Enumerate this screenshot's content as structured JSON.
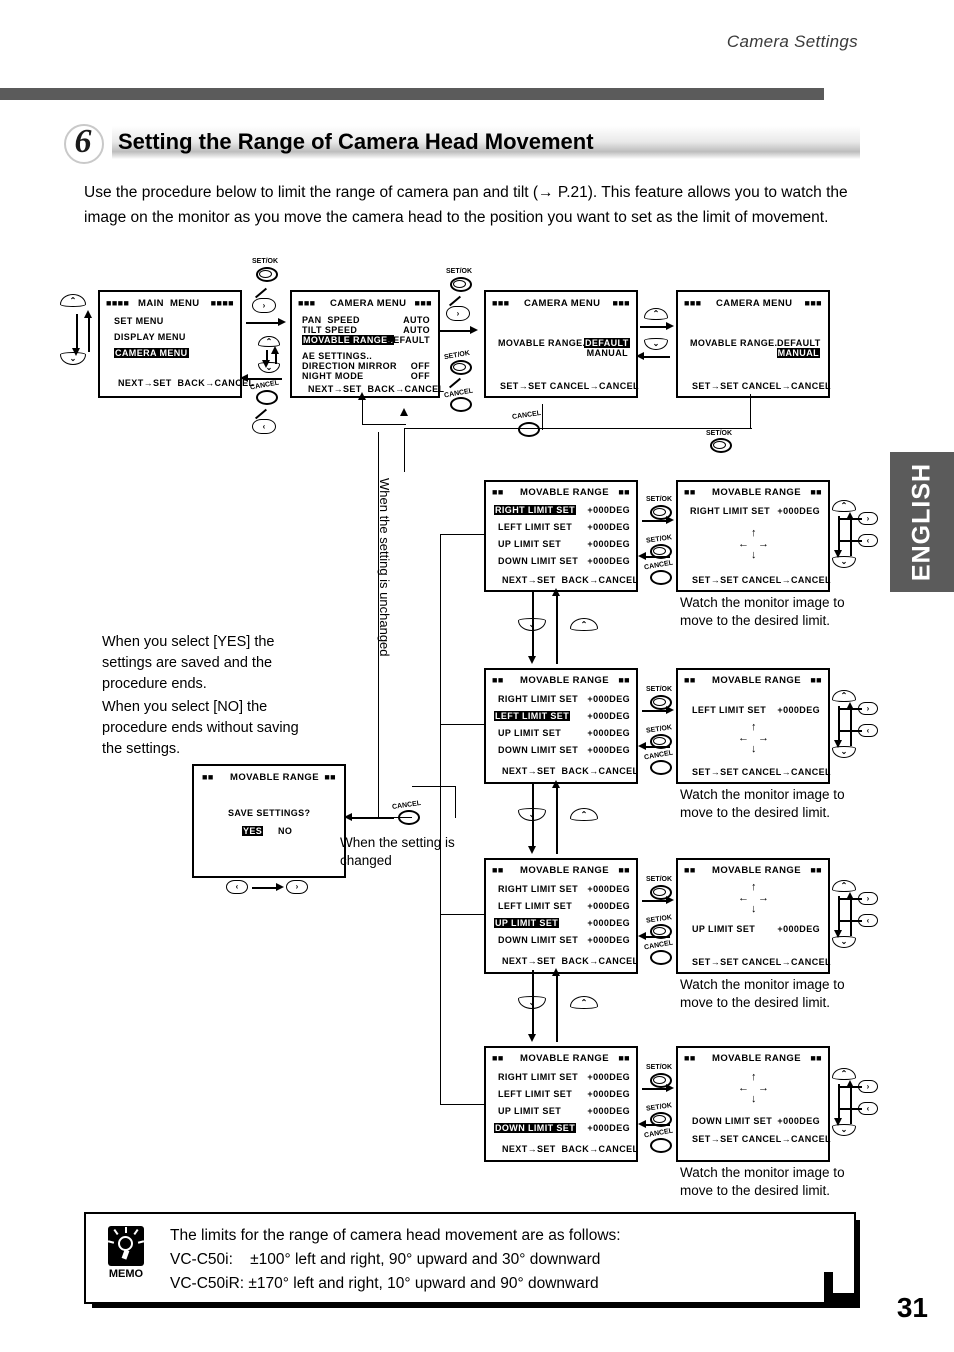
{
  "header": {
    "title": "Camera Settings",
    "side_tab": "ENGLISH",
    "page_number": "31"
  },
  "section": {
    "number": "6",
    "title": "Setting the Range of Camera Head Movement",
    "intro": "Use the procedure below to limit the range of camera pan and tilt (→ P.21). This feature allows you to watch the image on the monitor as you move the camera head to the position you want to set as the limit of movement."
  },
  "notes": {
    "yes_no": [
      "When you select [YES] the settings are saved and the procedure ends.",
      "When you select [NO] the procedure ends without saving the settings."
    ],
    "unchanged": "When the setting is unchanged",
    "changed": "When the setting is\nchanged",
    "watch": "Watch the monitor image to\nmove to the desired limit."
  },
  "buttons": {
    "set_ok": "SET/OK",
    "cancel": "CANCEL",
    "right": "›",
    "left": "‹",
    "up": "⌃",
    "down": "⌄"
  },
  "screens": {
    "main_menu": {
      "title": "MAIN  MENU",
      "deco_left": "■■■■",
      "deco_right": "■■■■",
      "items": [
        {
          "label": "SET MENU",
          "value": "",
          "selected": false
        },
        {
          "label": "DISPLAY MENU",
          "value": "",
          "selected": false
        },
        {
          "label": "CAMERA MENU",
          "value": "",
          "selected": true
        }
      ],
      "footer": "NEXT→SET  BACK→CANCEL"
    },
    "camera_menu": {
      "title": "CAMERA MENU",
      "deco_left": "■■■",
      "deco_right": "■■■",
      "items": [
        {
          "label": "PAN  SPEED",
          "value": "AUTO",
          "selected": false
        },
        {
          "label": "TILT SPEED",
          "value": "AUTO",
          "selected": false
        },
        {
          "label": "MOVABLE RANGE..",
          "value": "DEFAULT",
          "selected": true
        },
        {
          "label": "AE SETTINGS..",
          "value": "",
          "selected": false
        },
        {
          "label": "DIRECTION MIRROR",
          "value": "OFF",
          "selected": false
        },
        {
          "label": "NIGHT MODE",
          "value": "OFF",
          "selected": false
        }
      ],
      "footer": "NEXT→SET  BACK→CANCEL"
    },
    "movable_default": {
      "title": "CAMERA MENU",
      "deco_left": "■■■",
      "deco_right": "■■■",
      "label": "MOVABLE RANGE..",
      "option_a": "DEFAULT",
      "option_b": "MANUAL",
      "selected": "DEFAULT",
      "footer": "SET→SET CANCEL→CANCEL"
    },
    "movable_manual": {
      "title": "CAMERA MENU",
      "deco_left": "■■■",
      "deco_right": "■■■",
      "label": "MOVABLE RANGE..",
      "option_a": "DEFAULT",
      "option_b": "MANUAL",
      "selected": "MANUAL",
      "footer": "SET→SET CANCEL→CANCEL"
    },
    "range_list_title": "MOVABLE RANGE",
    "range_deco": "■■",
    "range_footer": "NEXT→SET  BACK→CANCEL",
    "detail_footer": "SET→SET CANCEL→CANCEL",
    "range_items": [
      {
        "label": "RIGHT LIMIT SET",
        "value": "+000DEG"
      },
      {
        "label": "LEFT LIMIT SET",
        "value": "+000DEG"
      },
      {
        "label": "UP LIMIT SET",
        "value": "+000DEG"
      },
      {
        "label": "DOWN LIMIT SET",
        "value": "+000DEG"
      }
    ],
    "save": {
      "title": "MOVABLE RANGE",
      "deco": "■■",
      "question": "SAVE SETTINGS?",
      "yes": "YES",
      "no": "NO",
      "selected": "YES"
    }
  },
  "memo": {
    "icon_label": "MEMO",
    "lines": [
      "The limits for the range of camera head movement are as follows:",
      "VC-C50i:    ±100° left and right, 90° upward and 30° downward",
      "VC-C50iR: ±170° left and right, 10° upward and 90° downward"
    ]
  }
}
